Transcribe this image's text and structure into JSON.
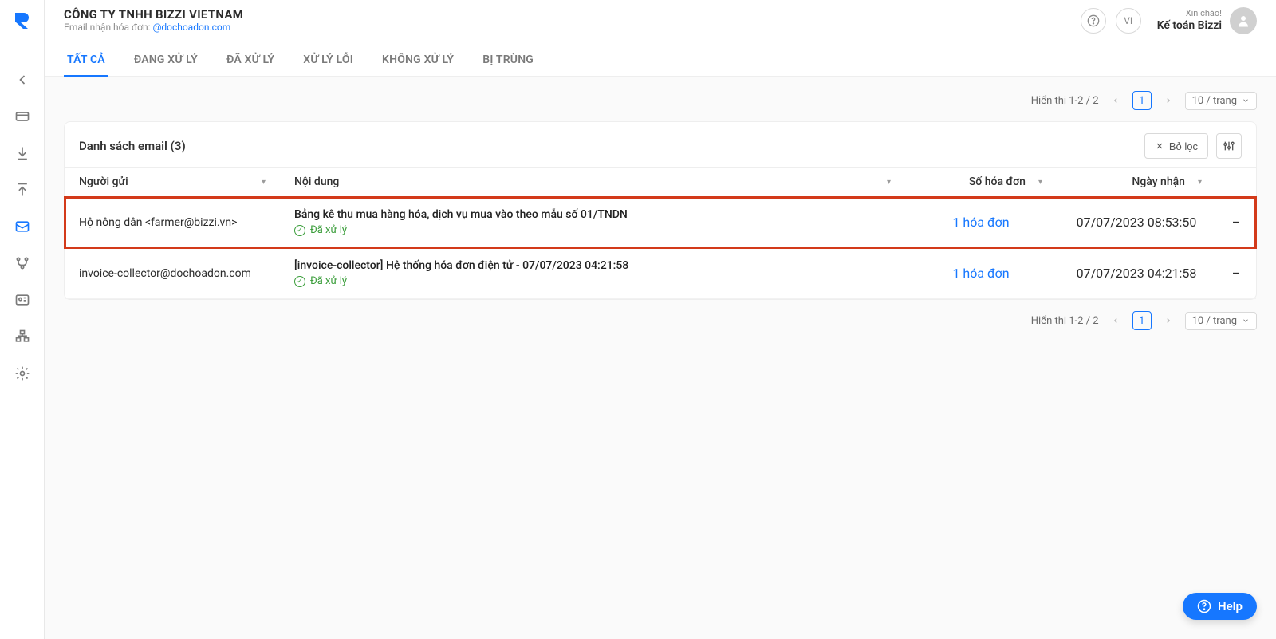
{
  "company": {
    "name": "CÔNG TY TNHH BIZZI VIETNAM",
    "email_label": "Email nhận hóa đơn: ",
    "email_value": "@dochoadon.com"
  },
  "topbar": {
    "locale": "VI",
    "greeting": "Xin chào!",
    "user_name": "Kế toán Bizzi"
  },
  "tabs": [
    {
      "label": "TẤT CẢ",
      "active": true
    },
    {
      "label": "ĐANG XỬ LÝ",
      "active": false
    },
    {
      "label": "ĐÃ XỬ LÝ",
      "active": false
    },
    {
      "label": "XỬ LÝ LỖI",
      "active": false
    },
    {
      "label": "KHÔNG XỬ LÝ",
      "active": false
    },
    {
      "label": "BỊ TRÙNG",
      "active": false
    }
  ],
  "pager": {
    "showing_text": "Hiển thị 1-2 / 2",
    "page": "1",
    "per_page": "10 / trang"
  },
  "panel": {
    "title": "Danh sách email (3)",
    "clear_filter": "Bỏ lọc"
  },
  "columns": {
    "sender": "Người gửi",
    "content": "Nội dung",
    "invoice_count": "Số hóa đơn",
    "received": "Ngày nhận",
    "actions_dash": "–"
  },
  "rows": [
    {
      "highlighted": true,
      "sender": "Hộ nông dân <farmer@bizzi.vn>",
      "subject": "Bảng kê thu mua hàng hóa, dịch vụ mua vào theo mẫu số 01/TNDN",
      "status": "Đã xử lý",
      "invoice": "1 hóa đơn",
      "date": "07/07/2023 08:53:50"
    },
    {
      "highlighted": false,
      "sender": "invoice-collector@dochoadon.com",
      "subject": "[invoice-collector] Hệ thống hóa đơn điện tử - 07/07/2023 04:21:58",
      "status": "Đã xử lý",
      "invoice": "1 hóa đơn",
      "date": "07/07/2023 04:21:58"
    }
  ],
  "help": {
    "label": "Help"
  }
}
